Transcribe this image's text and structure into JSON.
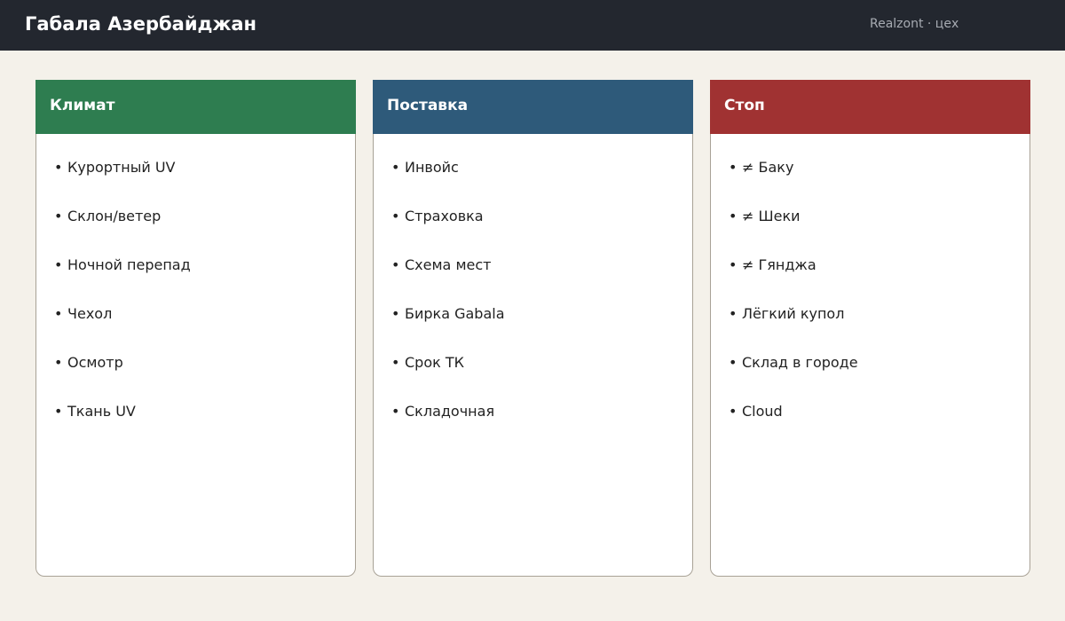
{
  "header": {
    "title": "Габала Азербайджан",
    "subtitle": "Realzont · цех"
  },
  "cards": [
    {
      "title": "Климат",
      "color": "#2e7d50",
      "items": [
        "Курортный UV",
        "Склон/ветер",
        "Ночной перепад",
        "Чехол",
        "Осмотр",
        "Ткань UV"
      ]
    },
    {
      "title": "Поставка",
      "color": "#2e5a7a",
      "items": [
        "Инвойс",
        "Страховка",
        "Схема мест",
        "Бирка Gabala",
        "Срок ТК",
        "Складочная"
      ]
    },
    {
      "title": "Стоп",
      "color": "#a03232",
      "items": [
        "≠ Баку",
        "≠ Шеки",
        "≠ Гянджа",
        "Лёгкий купол",
        "Склад в городе",
        "Cloud"
      ]
    }
  ],
  "bullet": "•"
}
